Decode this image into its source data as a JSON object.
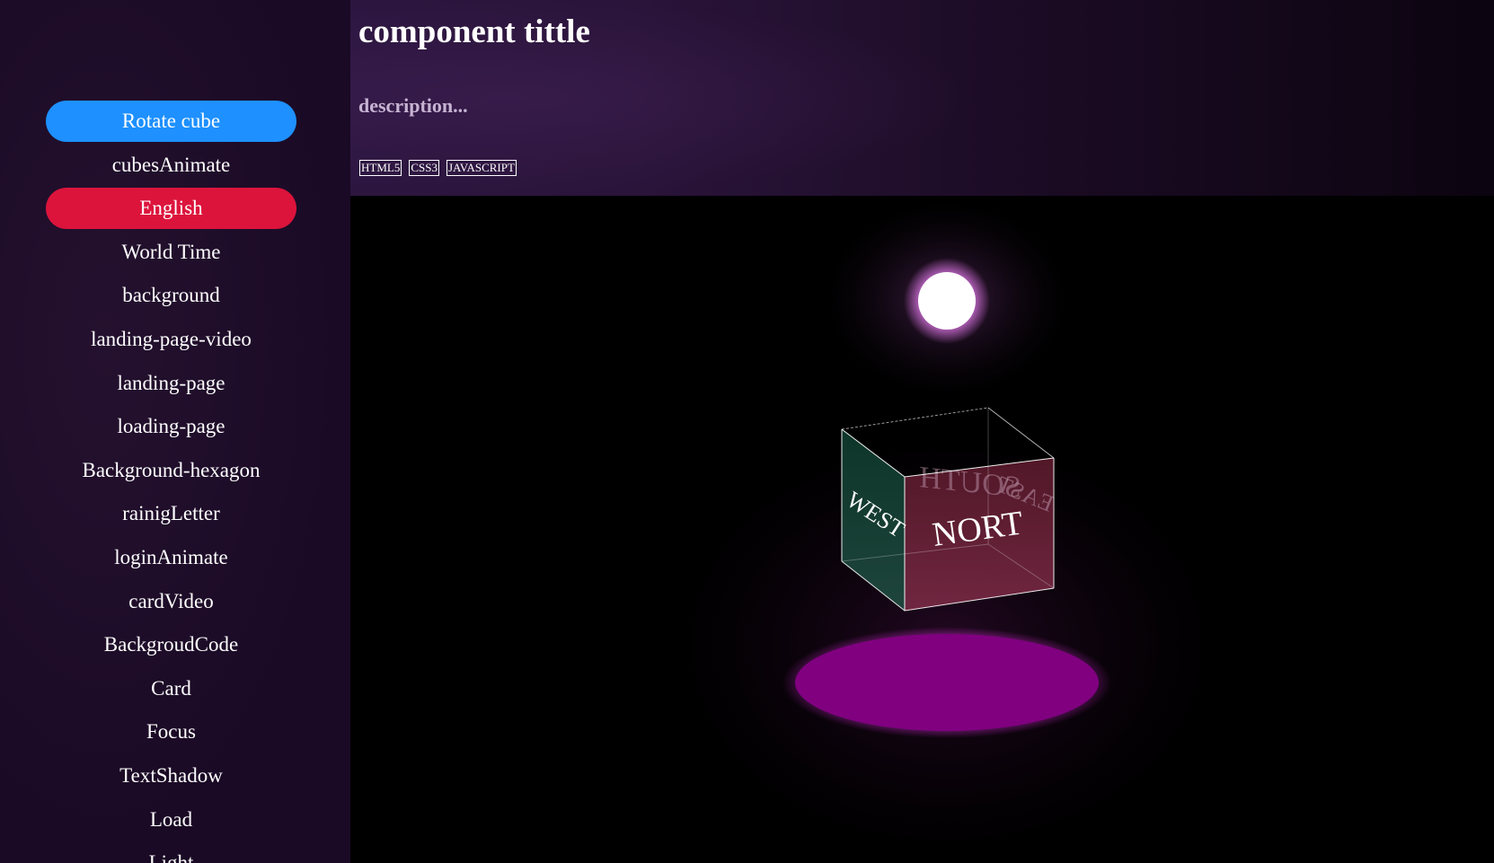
{
  "sidebar": {
    "items": [
      {
        "label": "Rotate cube",
        "state": "active-blue"
      },
      {
        "label": "cubesAnimate",
        "state": ""
      },
      {
        "label": "English",
        "state": "active-red"
      },
      {
        "label": "World Time",
        "state": ""
      },
      {
        "label": "background",
        "state": ""
      },
      {
        "label": "landing-page-video",
        "state": ""
      },
      {
        "label": "landing-page",
        "state": ""
      },
      {
        "label": "loading-page",
        "state": ""
      },
      {
        "label": "Background-hexagon",
        "state": ""
      },
      {
        "label": "rainigLetter",
        "state": ""
      },
      {
        "label": "loginAnimate",
        "state": ""
      },
      {
        "label": "cardVideo",
        "state": ""
      },
      {
        "label": "BackgroudCode",
        "state": ""
      },
      {
        "label": "Card",
        "state": ""
      },
      {
        "label": "Focus",
        "state": ""
      },
      {
        "label": "TextShadow",
        "state": ""
      },
      {
        "label": "Load",
        "state": ""
      },
      {
        "label": "Light",
        "state": ""
      }
    ]
  },
  "header": {
    "title": "component tittle",
    "description": "description...",
    "tags": [
      "HTML5",
      "CSS3",
      "JAVASCRIPT"
    ]
  },
  "scene": {
    "faces": {
      "north": "NORT",
      "south": "SOUTH",
      "east": "EAST",
      "west": "WEST"
    },
    "colors": {
      "accent_blue": "#1e90ff",
      "accent_red": "#dc143c",
      "light": "#ffffff",
      "light_glow": "#c04ec8",
      "floor": "#800080",
      "face_front": "#6a1a30",
      "face_left": "#0f3a2a"
    }
  }
}
